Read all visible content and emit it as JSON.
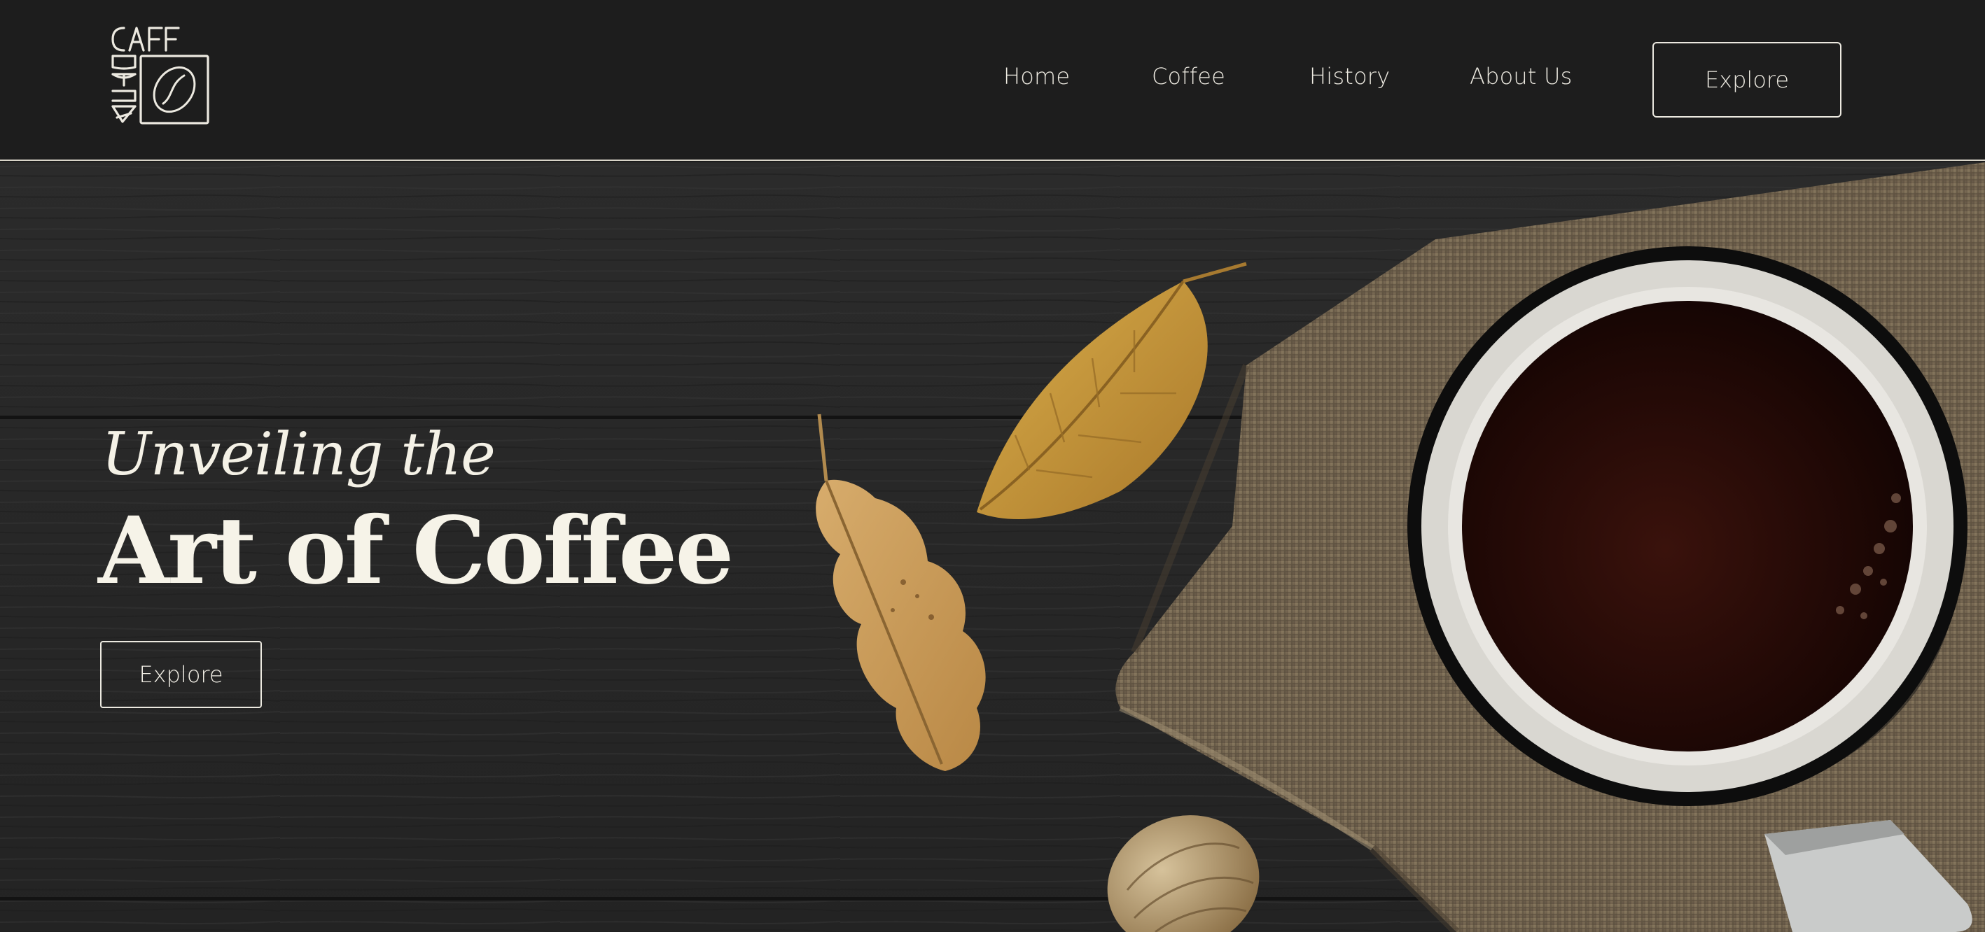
{
  "brand": {
    "logo_text": "CAFFEBRA",
    "logo_icon": "coffee-bean-icon"
  },
  "nav": {
    "items": [
      {
        "label": "Home"
      },
      {
        "label": "Coffee"
      },
      {
        "label": "History"
      },
      {
        "label": "About Us"
      }
    ],
    "cta_label": "Explore"
  },
  "hero": {
    "subtitle": "Unveiling the",
    "title": "Art of Coffee",
    "cta_label": "Explore",
    "image": "coffee-cup-on-burlap-with-leaves"
  },
  "colors": {
    "background": "#1c1c1c",
    "text_light": "#f4f1e6",
    "wood_dark": "#262626",
    "leaf_gold": "#c89a3a",
    "burlap": "#7a6a52"
  }
}
